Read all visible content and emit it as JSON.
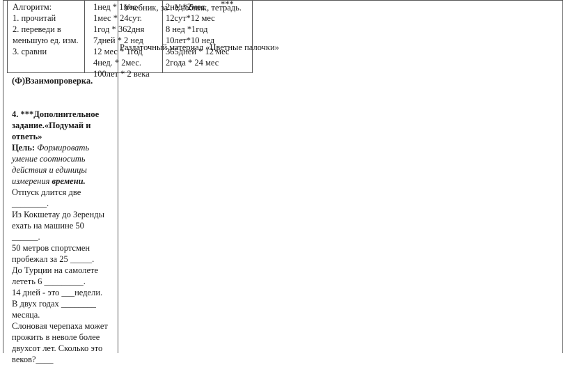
{
  "table": {
    "algorithm": [
      "Алгоритм:",
      "1. прочитай",
      "2. переведи в",
      "меньшую ед. изм.",
      "3. сравни"
    ],
    "column2": [
      "1нед * 1мес",
      "1мес * 24сут.",
      "1год * 362дня",
      "7дней * 2 нед",
      "12 мес * 1год",
      "4нед. * 2мес.",
      "100лет * 2 века"
    ],
    "column3": [
      "2нед*2мес",
      "12сут*12 мес",
      "8 нед *1год",
      "10лет*10 нед",
      "365дней * 12 мес",
      "2года  * 24 мес"
    ],
    "overlay1": "Учебник,  за . Учебник, тетрадь.",
    "overlay_stars": "***",
    "overlay2": "Раздаточный материал «Цветные палочки»"
  },
  "left": {
    "mutual_check": "(Ф)Взаимопроверка.",
    "task_title": [
      "4. ***Дополнительное",
      "задание.«Подумай и",
      "ответь»"
    ],
    "goal_label": "Цель:",
    "goal_text": [
      " Формировать",
      "умение соотносить",
      "действия и единицы",
      "измерения "
    ],
    "goal_bold_word": "времени.",
    "questions": [
      "Отпуск длится две",
      "________.",
      "Из Кокшетау до Зеренды",
      "ехать на машине 50",
      "______.",
      "50  метров спортсмен",
      "пробежал   за 25  _____.",
      "До Турции на самолете",
      "лететь   6  _________.",
      "14 дней - это ___недели.",
      "В  двух годах ________",
      "месяца.",
      "Слоновая черепаха может",
      "прожить  в  неволе  более",
      "двухсот  лет.  Сколько  это",
      "веков?____"
    ]
  }
}
